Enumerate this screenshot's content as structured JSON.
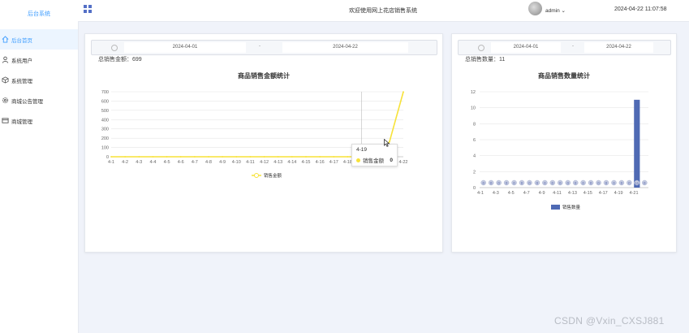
{
  "sidebar": {
    "brand": "后台系统",
    "items": [
      {
        "label": "后台首页",
        "icon": "home-icon",
        "active": true
      },
      {
        "label": "系统用户",
        "icon": "user-icon"
      },
      {
        "label": "系统管理",
        "icon": "box-icon"
      },
      {
        "label": "商城公告管理",
        "icon": "gear-icon"
      },
      {
        "label": "商城管理",
        "icon": "cart-icon"
      }
    ]
  },
  "header": {
    "welcome": "欢迎使用网上花店销售系统",
    "user": "admin",
    "datetime": "2024-04-22 11:07:58"
  },
  "sales_amount": {
    "start_date": "2024-04-01",
    "separator": "-",
    "end_date": "2024-04-22",
    "total_label": "总销售金额：",
    "total_value": "699",
    "tooltip": {
      "date": "4-19",
      "series": "销售金额",
      "value": "0"
    }
  },
  "sales_quantity": {
    "start_date": "2024-04-01",
    "separator": "-",
    "end_date": "2024-04-22",
    "total_label": "总销售数量：",
    "total_value": "11"
  },
  "watermark": "CSDN @Vxin_CXSJ881",
  "colors": {
    "line": "#f7e239",
    "bar": "#4f6ab4",
    "accent": "#409eff"
  },
  "chart_data": [
    {
      "type": "line",
      "title": "商品销售金额统计",
      "categories": [
        "4-1",
        "4-2",
        "4-3",
        "4-4",
        "4-5",
        "4-6",
        "4-7",
        "4-8",
        "4-9",
        "4-10",
        "4-11",
        "4-12",
        "4-13",
        "4-14",
        "4-15",
        "4-16",
        "4-17",
        "4-18",
        "4-19",
        "4-20",
        "4-21",
        "4-22"
      ],
      "series": [
        {
          "name": "销售金额",
          "values": [
            0,
            0,
            0,
            0,
            0,
            0,
            0,
            0,
            0,
            0,
            0,
            0,
            0,
            0,
            0,
            0,
            0,
            0,
            0,
            0,
            160,
            699
          ]
        }
      ],
      "ylim": [
        0,
        700
      ],
      "yticks": [
        0,
        100,
        200,
        300,
        400,
        500,
        600,
        700
      ],
      "legend": "bottom-center",
      "grid": true
    },
    {
      "type": "bar",
      "title": "商品销售数量统计",
      "categories": [
        "4-1",
        "4-2",
        "4-3",
        "4-4",
        "4-5",
        "4-6",
        "4-7",
        "4-8",
        "4-9",
        "4-10",
        "4-11",
        "4-12",
        "4-13",
        "4-14",
        "4-15",
        "4-16",
        "4-17",
        "4-18",
        "4-19",
        "4-20",
        "4-21",
        "4-22"
      ],
      "xtick_labels": [
        "4-1",
        "4-3",
        "4-5",
        "4-7",
        "4-9",
        "4-11",
        "4-13",
        "4-15",
        "4-17",
        "4-19",
        "4-21"
      ],
      "series": [
        {
          "name": "销售数量",
          "values": [
            0,
            0,
            0,
            0,
            0,
            0,
            0,
            0,
            0,
            0,
            0,
            0,
            0,
            0,
            0,
            0,
            0,
            0,
            0,
            0,
            11,
            0
          ]
        }
      ],
      "ylim": [
        0,
        12
      ],
      "yticks": [
        0,
        2,
        4,
        6,
        8,
        10,
        12
      ],
      "legend": "bottom-center",
      "grid": true
    }
  ]
}
